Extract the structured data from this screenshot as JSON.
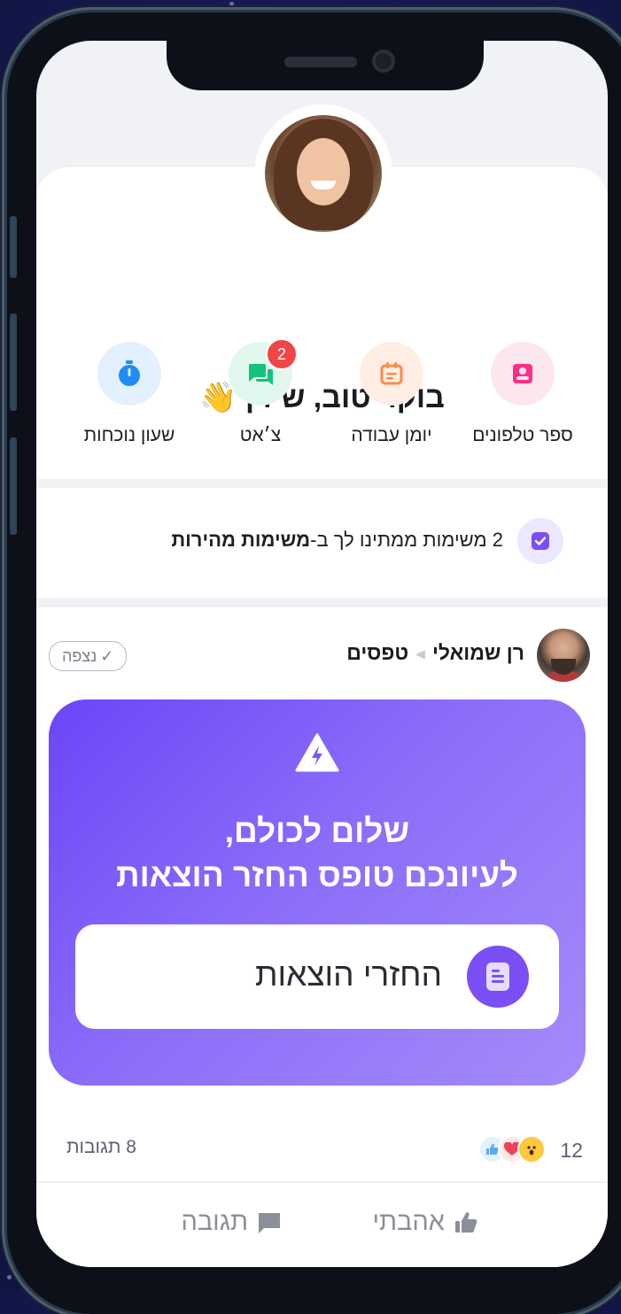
{
  "header": {
    "greeting": "בוקר טוב, שירן",
    "greeting_emoji": "👋"
  },
  "quick_actions": [
    {
      "label": "ספר טלפונים",
      "icon": "contact-book-icon",
      "color": "#ff2d8a",
      "bg": "#fde7ef"
    },
    {
      "label": "יומן עבודה",
      "icon": "calendar-icon",
      "color": "#ff8a4a",
      "bg": "#ffeee3"
    },
    {
      "label": "צ׳אט",
      "icon": "chat-icon",
      "color": "#15c27a",
      "bg": "#e2f8ef",
      "badge": "2"
    },
    {
      "label": "שעון נוכחות",
      "icon": "stopwatch-icon",
      "color": "#1f8df2",
      "bg": "#e3f1fe"
    }
  ],
  "tasks": {
    "text_prefix": "2 משימות ממתינו לך ב-",
    "text_bold": "משימות מהירות"
  },
  "post": {
    "author": "רן שמואלי",
    "channel": "טפסים",
    "seen_label": "נצפה",
    "promo_title_line1": "שלום לכולם,",
    "promo_title_line2": "לעיונכם טופס החזר הוצאות",
    "promo_button_label": "החזרי הוצאות",
    "reaction_count": "12",
    "comments_label": "8 תגובות",
    "like_label": "אהבתי",
    "comment_label": "תגובה"
  },
  "colors": {
    "accent_purple": "#7a4ff5",
    "like_blue": "#5aa9f5",
    "heart_red": "#f0405a",
    "wow_yellow": "#ffc83d"
  }
}
